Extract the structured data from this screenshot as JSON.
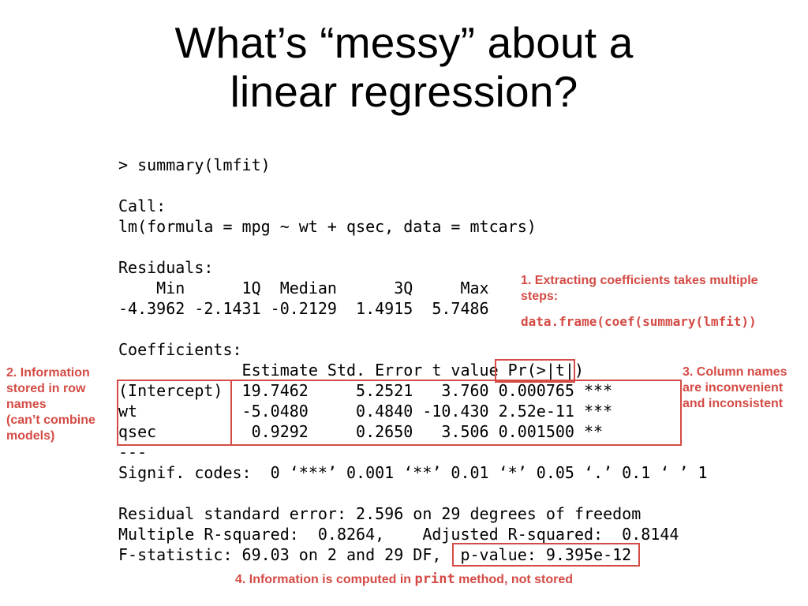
{
  "title_line1": "What’s “messy” about a",
  "title_line2": "linear regression?",
  "code_block": "> summary(lmfit)\n\nCall:\nlm(formula = mpg ~ wt + qsec, data = mtcars)\n\nResiduals:\n    Min      1Q  Median      3Q     Max \n-4.3962 -2.1431 -0.2129  1.4915  5.7486 \n\nCoefficients:\n             Estimate Std. Error t value Pr(>|t|)    \n(Intercept)  19.7462     5.2521   3.760 0.000765 ***\nwt           -5.0480     0.4840 -10.430 2.52e-11 ***\nqsec          0.9292     0.2650   3.506 0.001500 ** \n---\nSignif. codes:  0 ‘***’ 0.001 ‘**’ 0.01 ‘*’ 0.05 ‘.’ 0.1 ‘ ’ 1\n\nResidual standard error: 2.596 on 29 degrees of freedom\nMultiple R-squared:  0.8264,\tAdjusted R-squared:  0.8144 \nF-statistic: 69.03 on 2 and 29 DF,  p-value: 9.395e-12",
  "anno1_text": "1. Extracting coefficients takes multiple steps:",
  "anno1_code": "data.frame(coef(summary(lmfit))",
  "anno2_text": "2. Information stored in row names\n(can’t combine models)",
  "anno3_text": "3. Column names are inconvenient and inconsistent",
  "anno4_part1": "4. Information is computed in ",
  "anno4_code": "print",
  "anno4_part2": " method, not stored",
  "colors": {
    "annotation": "#d44b45"
  }
}
